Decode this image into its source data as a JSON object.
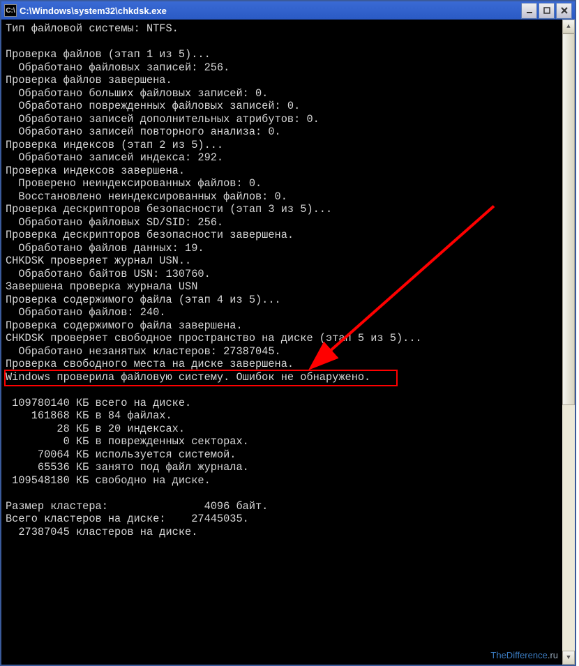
{
  "window": {
    "title": "C:\\Windows\\system32\\chkdsk.exe"
  },
  "lines": [
    "Тип файловой системы: NTFS.",
    "",
    "Проверка файлов (этап 1 из 5)...",
    "  Обработано файловых записей: 256.",
    "Проверка файлов завершена.",
    "  Обработано больших файловых записей: 0.",
    "  Обработано поврежденных файловых записей: 0.",
    "  Обработано записей дополнительных атрибутов: 0.",
    "  Обработано записей повторного анализа: 0.",
    "Проверка индексов (этап 2 из 5)...",
    "  Обработано записей индекса: 292.",
    "Проверка индексов завершена.",
    "  Проверено неиндексированных файлов: 0.",
    "  Восстановлено неиндексированных файлов: 0.",
    "Проверка дескрипторов безопасности (этап 3 из 5)...",
    "  Обработано файловых SD/SID: 256.",
    "Проверка дескрипторов безопасности завершена.",
    "  Обработано файлов данных: 19.",
    "CHKDSK проверяет журнал USN..",
    "  Обработано байтов USN: 130760.",
    "Завершена проверка журнала USN",
    "Проверка содержимого файла (этап 4 из 5)...",
    "  Обработано файлов: 240.",
    "Проверка содержимого файла завершена.",
    "CHKDSK проверяет свободное пространство на диске (этап 5 из 5)...",
    "  Обработано незанятых кластеров: 27387045.",
    "Проверка свободного места на диске завершена.",
    "Windows проверила файловую систему. Ошибок не обнаружено.",
    "",
    " 109780140 КБ всего на диске.",
    "    161868 КБ в 84 файлах.",
    "        28 КБ в 20 индексах.",
    "         0 КБ в поврежденных секторах.",
    "     70064 КБ используется системой.",
    "     65536 КБ занято под файл журнала.",
    " 109548180 КБ свободно на диске.",
    "",
    "Размер кластера:               4096 байт.",
    "Всего кластеров на диске:    27445035.",
    "  27387045 кластеров на диске.",
    "",
    ""
  ],
  "highlight_line_index": 27,
  "watermark": {
    "main": "TheDifference",
    "suffix": ".ru"
  }
}
